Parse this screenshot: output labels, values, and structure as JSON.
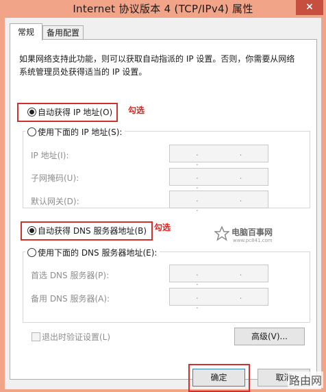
{
  "window": {
    "title": "Internet 协议版本 4 (TCP/IPv4) 属性",
    "close_glyph": "×"
  },
  "tabs": [
    {
      "label": "常规",
      "selected": true
    },
    {
      "label": "备用配置",
      "selected": false
    }
  ],
  "description": "如果网络支持此功能，则可以获取自动指派的 IP 设置。否则，你需要从网络系统管理员处获得适当的 IP 设置。",
  "ip_section": {
    "auto_label": "自动获得 IP 地址(O)",
    "auto_selected": true,
    "manual_label": "使用下面的 IP 地址(S):",
    "manual_selected": false,
    "annotation": "勾选",
    "fields": [
      {
        "label": "IP 地址(I):",
        "value": ". . ."
      },
      {
        "label": "子网掩码(U):",
        "value": ". . ."
      },
      {
        "label": "默认网关(D):",
        "value": ". . ."
      }
    ]
  },
  "dns_section": {
    "auto_label": "自动获得 DNS 服务器地址(B)",
    "auto_selected": true,
    "manual_label": "使用下面的 DNS 服务器地址(E):",
    "manual_selected": false,
    "annotation": "勾选",
    "fields": [
      {
        "label": "首选 DNS 服务器(P):",
        "value": ". . ."
      },
      {
        "label": "备用 DNS 服务器(A):",
        "value": ". . ."
      }
    ]
  },
  "validate_on_exit": {
    "label": "退出时验证设置(L)",
    "checked": false
  },
  "advanced_button": "高级(V)...",
  "ok_button": "确定",
  "cancel_button": "取消",
  "watermarks": {
    "center_logo": "电脑百事网",
    "center_url": "www.pc841.com",
    "corner": "路由网"
  },
  "colors": {
    "title_bar": "#f2a488",
    "close_button": "#c74f3f",
    "highlight_box": "#d0312d",
    "annotation_text": "#e0201c"
  }
}
